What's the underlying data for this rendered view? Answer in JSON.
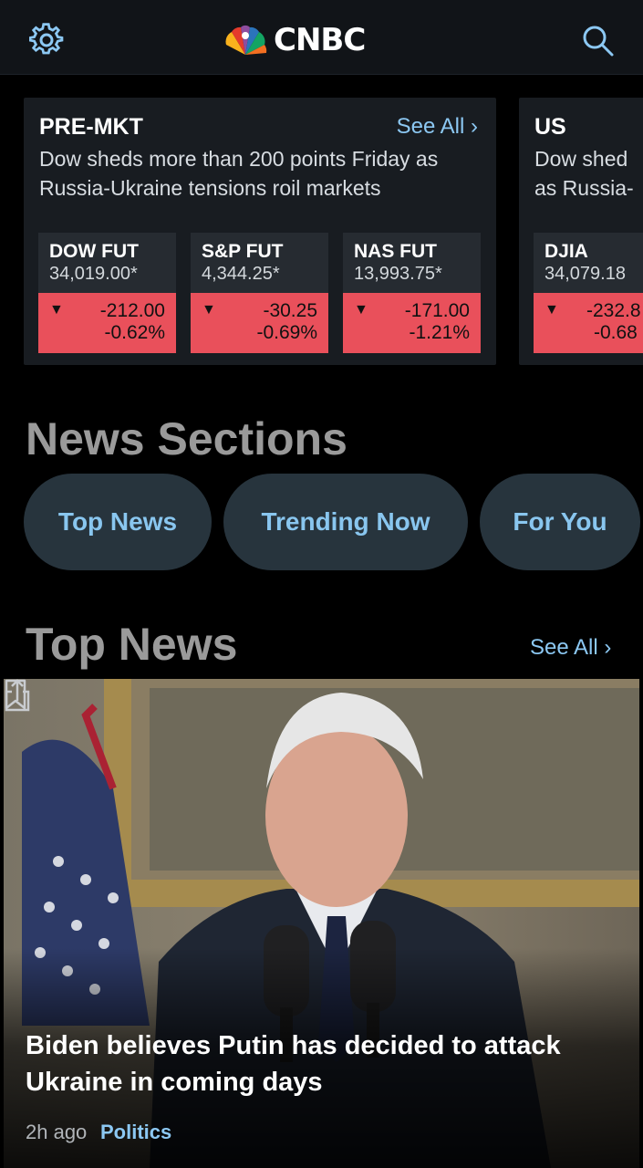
{
  "header": {
    "logo_text": "CNBC",
    "settings_icon": "gear-icon",
    "search_icon": "search-icon"
  },
  "markets": [
    {
      "label": "PRE-MKT",
      "see_all": "See All ›",
      "headline": "Dow sheds more than 200 points Friday as Russia-Ukraine tensions roil markets",
      "tiles": [
        {
          "name": "DOW FUT",
          "price": "34,019.00*",
          "change": "-212.00",
          "pct": "-0.62%"
        },
        {
          "name": "S&P FUT",
          "price": "4,344.25*",
          "change": "-30.25",
          "pct": "-0.69%"
        },
        {
          "name": "NAS FUT",
          "price": "13,993.75*",
          "change": "-171.00",
          "pct": "-1.21%"
        }
      ]
    },
    {
      "label": "US",
      "headline": "Dow shed as Russia-",
      "tiles": [
        {
          "name": "DJIA",
          "price": "34,079.18",
          "change": "-232.8",
          "pct": "-0.68"
        }
      ]
    }
  ],
  "news_sections": {
    "title": "News Sections",
    "pills": [
      "Top News",
      "Trending Now",
      "For You"
    ]
  },
  "top_news": {
    "title": "Top News",
    "see_all": "See All ›",
    "hero": {
      "headline": "Biden believes Putin has decided to attack Ukraine in coming days",
      "time": "2h ago",
      "tag": "Politics"
    }
  },
  "colors": {
    "accent": "#8cc8f3",
    "negative": "#e9505b",
    "card_bg": "#181c21",
    "pill_bg": "#27343d"
  }
}
